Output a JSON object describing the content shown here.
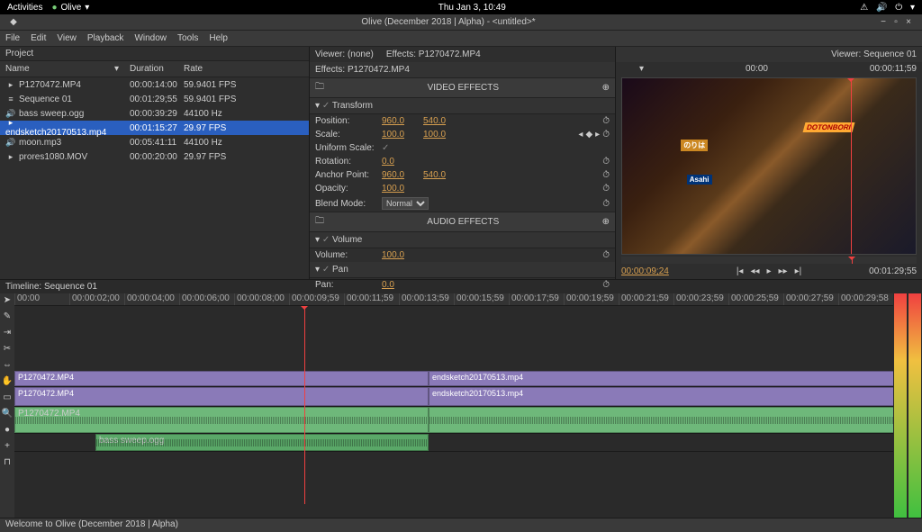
{
  "topbar": {
    "activities": "Activities",
    "app": "Olive",
    "datetime": "Thu Jan  3, 10:49"
  },
  "titlebar": {
    "title": "Olive (December 2018 | Alpha) - <untitled>*"
  },
  "menu": [
    "File",
    "Edit",
    "View",
    "Playback",
    "Window",
    "Tools",
    "Help"
  ],
  "project": {
    "title": "Project",
    "cols": {
      "name": "Name",
      "duration": "Duration",
      "rate": "Rate"
    },
    "items": [
      {
        "icon": "▸",
        "name": "P1270472.MP4",
        "dur": "00:00:14:00",
        "rate": "59.9401 FPS"
      },
      {
        "icon": "≡",
        "name": "Sequence 01",
        "dur": "00:01:29;55",
        "rate": "59.9401 FPS"
      },
      {
        "icon": "🔊",
        "name": "bass sweep.ogg",
        "dur": "00:00:39:29",
        "rate": "44100 Hz"
      },
      {
        "icon": "▸",
        "name": "endsketch20170513.mp4",
        "dur": "00:01:15:27",
        "rate": "29.97 FPS"
      },
      {
        "icon": "🔊",
        "name": "moon.mp3",
        "dur": "00:05:41:11",
        "rate": "44100 Hz"
      },
      {
        "icon": "▸",
        "name": "prores1080.MOV",
        "dur": "00:00:20:00",
        "rate": "29.97 FPS"
      }
    ]
  },
  "effects": {
    "viewer_none": "Viewer: (none)",
    "effects_label": "Effects: P1270472.MP4",
    "title": "Effects: P1270472.MP4",
    "video_section": "VIDEO EFFECTS",
    "audio_section": "AUDIO EFFECTS",
    "transform": "Transform",
    "position": "Position:",
    "pos_x": "960.0",
    "pos_y": "540.0",
    "scale": "Scale:",
    "scale_x": "100.0",
    "scale_y": "100.0",
    "uniform": "Uniform Scale:",
    "rotation": "Rotation:",
    "rot_v": "0.0",
    "anchor": "Anchor Point:",
    "anc_x": "960.0",
    "anc_y": "540.0",
    "opacity": "Opacity:",
    "opa_v": "100.0",
    "blend": "Blend Mode:",
    "blend_v": "Normal",
    "volume_group": "Volume",
    "volume": "Volume:",
    "vol_v": "100.0",
    "pan_group": "Pan",
    "pan": "Pan:",
    "pan_v": "0.0"
  },
  "viewer": {
    "title": "Viewer: Sequence 01",
    "start": "00:00",
    "end": "00:00:11;59",
    "signs": {
      "nori": "のりは",
      "asahi": "Asahi",
      "doton": "DOTONBORI"
    },
    "tc_left": "00:00:09;24",
    "tc_right": "00:01:29;55"
  },
  "timeline": {
    "title": "Timeline: Sequence 01",
    "marks": [
      "00:00",
      "00:00:02;00",
      "00:00:04;00",
      "00:00:06;00",
      "00:00:08;00",
      "00:00:09;59",
      "00:00:11;59",
      "00:00:13;59",
      "00:00:15;59",
      "00:00:17;59",
      "00:00:19;59",
      "00:00:21;59",
      "00:00:23;59",
      "00:00:25;59",
      "00:00:27;59",
      "00:00:29;58"
    ],
    "clips": {
      "v1a": "P1270472.MP4",
      "v1b": "endsketch20170513.mp4",
      "v2a": "P1270472.MP4",
      "v2b": "endsketch20170513.mp4",
      "a1": "P1270472.MP4",
      "a2": "bass sweep.ogg"
    }
  },
  "status": "Welcome to Olive (December 2018 | Alpha)"
}
